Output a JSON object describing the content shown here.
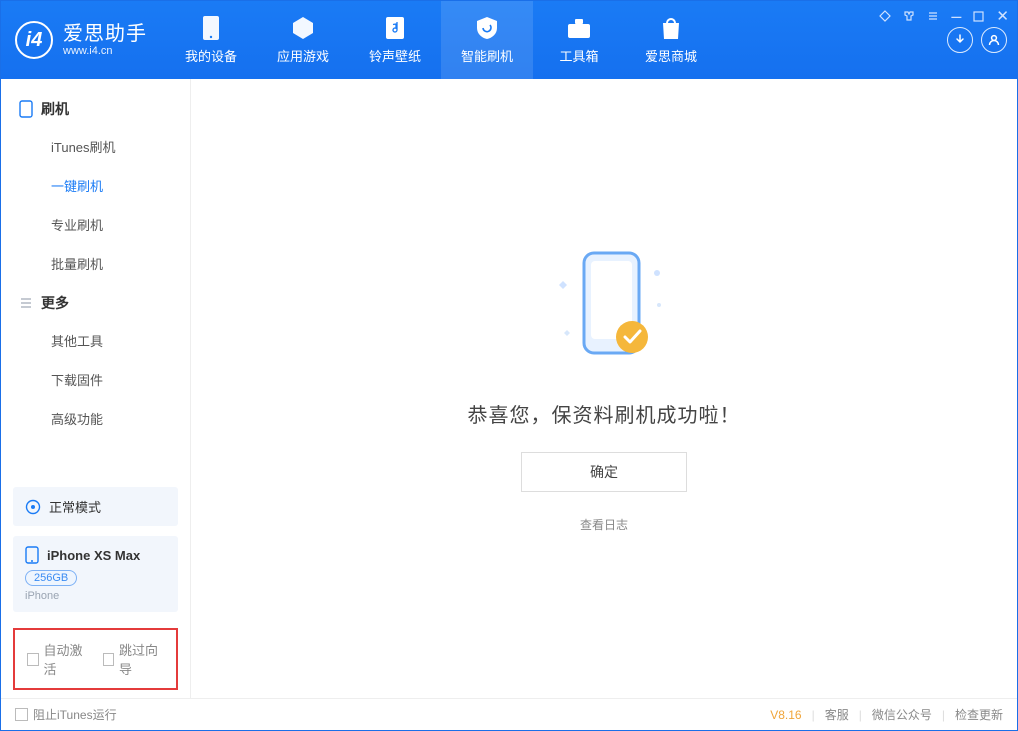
{
  "header": {
    "title": "爱思助手",
    "url": "www.i4.cn",
    "tabs": [
      "我的设备",
      "应用游戏",
      "铃声壁纸",
      "智能刷机",
      "工具箱",
      "爱思商城"
    ]
  },
  "sidebar": {
    "group1": {
      "title": "刷机",
      "items": [
        "iTunes刷机",
        "一键刷机",
        "专业刷机",
        "批量刷机"
      ]
    },
    "group2": {
      "title": "更多",
      "items": [
        "其他工具",
        "下载固件",
        "高级功能"
      ]
    },
    "mode": "正常模式",
    "device": {
      "name": "iPhone XS Max",
      "capacity": "256GB",
      "type": "iPhone"
    },
    "options": [
      "自动激活",
      "跳过向导"
    ]
  },
  "content": {
    "message": "恭喜您，保资料刷机成功啦！",
    "ok": "确定",
    "viewLog": "查看日志"
  },
  "footer": {
    "blockItunes": "阻止iTunes运行",
    "version": "V8.16",
    "links": [
      "客服",
      "微信公众号",
      "检查更新"
    ]
  }
}
